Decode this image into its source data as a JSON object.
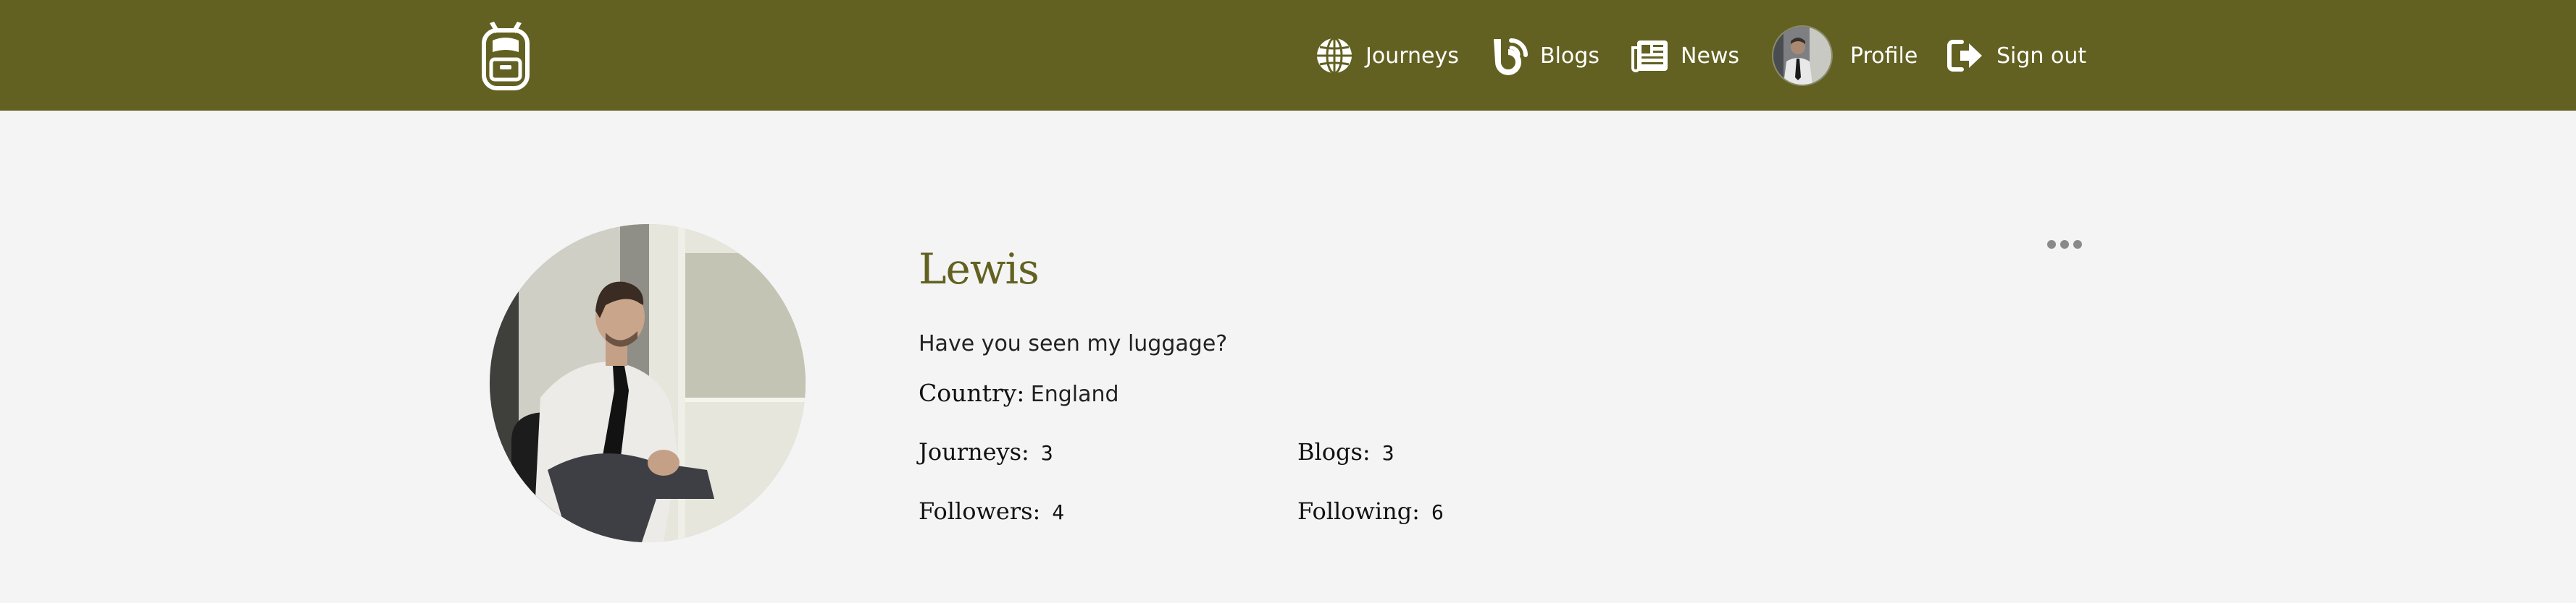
{
  "nav": {
    "logo_icon": "backpack-icon",
    "items": [
      {
        "label": "Journeys",
        "icon": "globe-icon"
      },
      {
        "label": "Blogs",
        "icon": "blog-icon"
      },
      {
        "label": "News",
        "icon": "newspaper-icon"
      },
      {
        "label": "Profile",
        "icon": "avatar"
      },
      {
        "label": "Sign out",
        "icon": "sign-out-icon"
      }
    ]
  },
  "profile": {
    "name": "Lewis",
    "bio": "Have you seen my luggage?",
    "country_label": "Country:",
    "country": "England",
    "stats": {
      "journeys_label": "Journeys:",
      "journeys": "3",
      "blogs_label": "Blogs:",
      "blogs": "3",
      "followers_label": "Followers:",
      "followers": "4",
      "following_label": "Following:",
      "following": "6"
    }
  },
  "colors": {
    "navbar": "#626121",
    "accent": "#626121",
    "background": "#f4f4f4"
  }
}
